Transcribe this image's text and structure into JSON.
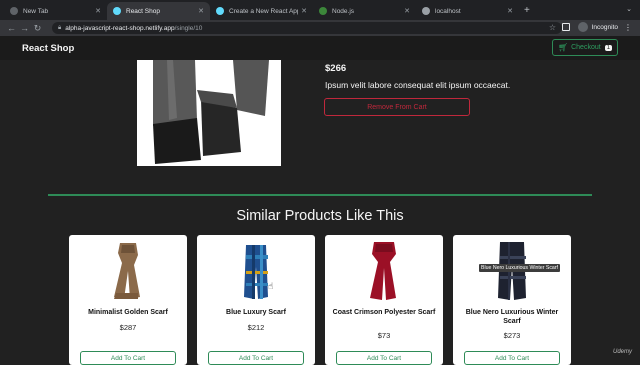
{
  "browser": {
    "tabs": [
      {
        "title": "New Tab",
        "favicon_color": "#5f6368",
        "active": false
      },
      {
        "title": "React Shop",
        "favicon_color": "#61dafb",
        "active": true
      },
      {
        "title": "Create a New React App – Rea",
        "favicon_color": "#61dafb",
        "active": false
      },
      {
        "title": "Node.js",
        "favicon_color": "#3c873a",
        "active": false
      },
      {
        "title": "localhost",
        "favicon_color": "#9aa0a6",
        "active": false
      }
    ],
    "address": {
      "host": "alpha-javascript-react-shop.netlify.app",
      "path": "/single/10"
    },
    "profile_label": "Incognito"
  },
  "site": {
    "brand": "React Shop",
    "checkout_label": "Checkout",
    "cart_count": "1",
    "accent_color": "#2e8b57",
    "danger_color": "#c0283c"
  },
  "product": {
    "price": "$266",
    "description": "Ipsum velit labore consequat elit ipsum occaecat.",
    "remove_label": "Remove From Cart"
  },
  "similar": {
    "title": "Similar Products Like This",
    "add_label": "Add To Cart",
    "items": [
      {
        "name": "Minimalist Golden Scarf",
        "price": "$287"
      },
      {
        "name": "Blue Luxury Scarf",
        "price": "$212"
      },
      {
        "name": "Coast Crimson Polyester Scarf",
        "price": "$73"
      },
      {
        "name": "Blue Nero Luxurious Winter Scarf",
        "price": "$273"
      }
    ],
    "tooltip": "Blue Nero Luxurious Winter Scarf"
  },
  "watermark": "Udemy"
}
